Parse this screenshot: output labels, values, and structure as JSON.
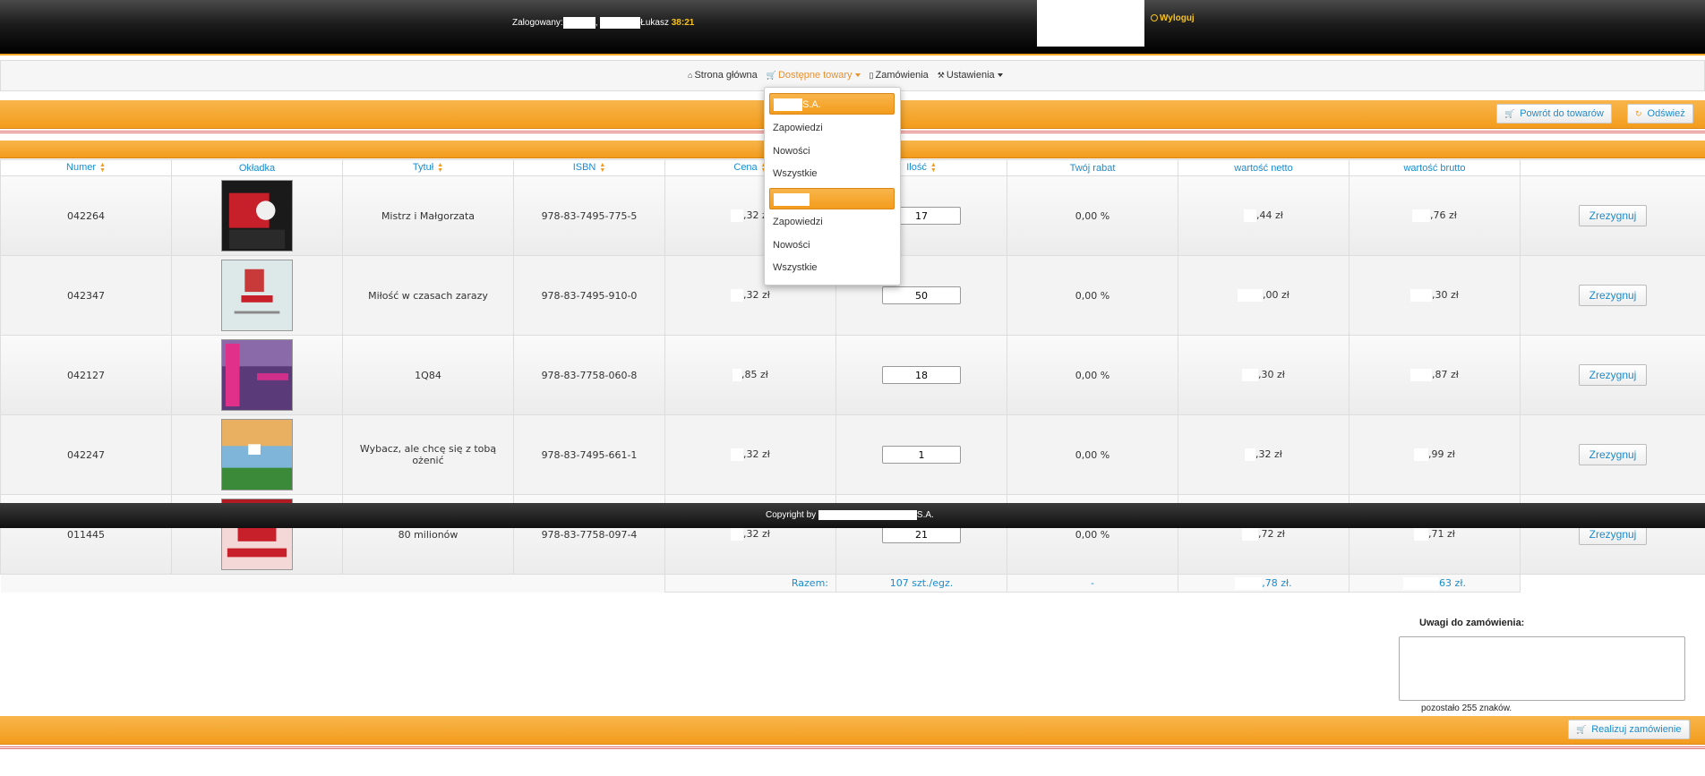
{
  "header": {
    "logged_label": "Zalogowany:",
    "sep": ",",
    "user": "Łukasz",
    "timer": "38:21",
    "logout": "Wyloguj"
  },
  "nav": {
    "home": "Strona główna",
    "products": "Dostępne towary",
    "orders": "Zamówienia",
    "settings": "Ustawienia"
  },
  "dropdown": {
    "group1_title": "S.A.",
    "group1_items": [
      "Zapowiedzi",
      "Nowości",
      "Wszystkie"
    ],
    "group2_title": "",
    "group2_items": [
      "Zapowiedzi",
      "Nowości",
      "Wszystkie"
    ]
  },
  "toolbar": {
    "back": "Powrót do towarów",
    "refresh": "Odśwież"
  },
  "table": {
    "headers": [
      "Numer",
      "Okładka",
      "Tytuł",
      "ISBN",
      "Cena",
      "Ilość",
      "Twój rabat",
      "wartość netto",
      "wartość brutto"
    ],
    "rows": [
      {
        "numer": "042264",
        "tytul": "Mistrz i Małgorzata",
        "isbn": "978-83-7495-775-5",
        "cena": ",32 zł",
        "ilosc": "17",
        "rabat": "0,00 %",
        "netto": ",44 zł",
        "brutto": ",76 zł",
        "action": "Zrezygnuj"
      },
      {
        "numer": "042347",
        "tytul": "Miłość w czasach zarazy",
        "isbn": "978-83-7495-910-0",
        "cena": ",32 zł",
        "ilosc": "50",
        "rabat": "0,00 %",
        "netto": ",00 zł",
        "brutto": ",30 zł",
        "action": "Zrezygnuj"
      },
      {
        "numer": "042127",
        "tytul": "1Q84",
        "isbn": "978-83-7758-060-8",
        "cena": ",85 zł",
        "ilosc": "18",
        "rabat": "0,00 %",
        "netto": ",30 zł",
        "brutto": ",87 zł",
        "action": "Zrezygnuj"
      },
      {
        "numer": "042247",
        "tytul": "Wybacz, ale chcę się z tobą ożenić",
        "isbn": "978-83-7495-661-1",
        "cena": ",32 zł",
        "ilosc": "1",
        "rabat": "0,00 %",
        "netto": ",32 zł",
        "brutto": ",99 zł",
        "action": "Zrezygnuj"
      },
      {
        "numer": "011445",
        "tytul": "80 milionów",
        "isbn": "978-83-7758-097-4",
        "cena": ",32 zł",
        "ilosc": "21",
        "rabat": "0,00 %",
        "netto": ",72 zł",
        "brutto": ",71 zł",
        "action": "Zrezygnuj"
      }
    ],
    "summary": {
      "label": "Razem:",
      "qty": "107 szt./egz.",
      "rabat": "-",
      "netto": ",78 zł.",
      "brutto": "63 zł."
    }
  },
  "footer": {
    "copyright_prefix": "Copyright by",
    "copyright_suffix": "S.A."
  },
  "notes": {
    "label": "Uwagi do zamówienia:",
    "remaining": "pozostało 255 znaków."
  },
  "bottom": {
    "submit": "Realizuj zamówienie"
  },
  "colors": {
    "accent": "#f39c1c",
    "link": "#1a8ccf",
    "timer": "#f7c21b"
  }
}
